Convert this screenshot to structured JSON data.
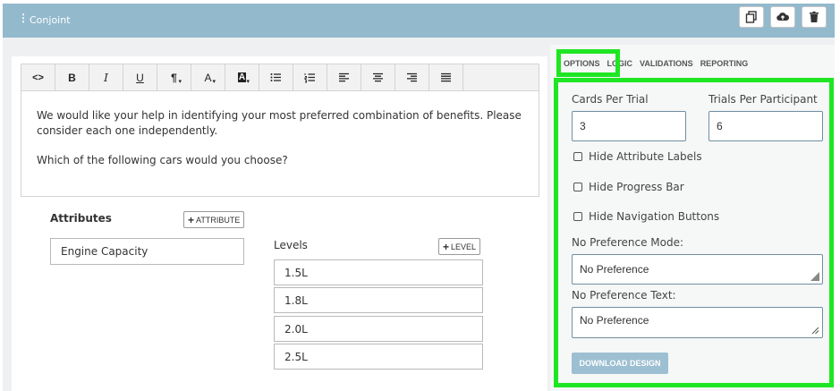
{
  "window": {
    "title": "Conjoint",
    "grip_glyph": "⋮",
    "actions": [
      {
        "name": "copy-icon"
      },
      {
        "name": "cloud-upload-icon"
      },
      {
        "name": "trash-icon"
      }
    ]
  },
  "editor": {
    "toolbar": [
      {
        "name": "code-view-icon",
        "glyph": "<>"
      },
      {
        "name": "bold-icon",
        "glyph": "B"
      },
      {
        "name": "italic-icon",
        "glyph": "I"
      },
      {
        "name": "underline-icon",
        "glyph": "U"
      },
      {
        "name": "paragraph-icon",
        "glyph": "¶"
      },
      {
        "name": "font-color-icon",
        "glyph": "A"
      },
      {
        "name": "background-color-icon",
        "glyph": "A"
      },
      {
        "name": "bullet-list-icon",
        "glyph": ""
      },
      {
        "name": "numbered-list-icon",
        "glyph": ""
      },
      {
        "name": "align-left-icon",
        "glyph": ""
      },
      {
        "name": "align-center-icon",
        "glyph": ""
      },
      {
        "name": "align-right-icon",
        "glyph": ""
      },
      {
        "name": "justify-icon",
        "glyph": ""
      }
    ],
    "paragraph1": "We would like your help in identifying your most preferred combination of benefits. Please consider each one independently.",
    "paragraph2": "Which of the following cars would you choose?"
  },
  "attributes": {
    "heading": "Attributes",
    "add_button": "ATTRIBUTE",
    "items": [
      "Engine Capacity"
    ]
  },
  "levels": {
    "heading": "Levels",
    "add_button": "LEVEL",
    "items": [
      "1.5L",
      "1.8L",
      "2.0L",
      "2.5L"
    ]
  },
  "tabs": [
    "OPTIONS",
    "LOGIC",
    "VALIDATIONS",
    "REPORTING"
  ],
  "options": {
    "cards_per_trial_label": "Cards Per Trial",
    "cards_per_trial_value": "3",
    "trials_per_participant_label": "Trials Per Participant",
    "trials_per_participant_value": "6",
    "checkboxes": [
      "Hide Attribute Labels",
      "Hide Progress Bar",
      "Hide Navigation Buttons"
    ],
    "no_pref_mode_label": "No Preference Mode:",
    "no_pref_mode_value": "No Preference",
    "no_pref_text_label": "No Preference Text:",
    "no_pref_text_value": "No Preference",
    "download_button": "DOWNLOAD DESIGN"
  },
  "colors": {
    "titlebar": "#93b9cc",
    "highlight": "#1ee623",
    "download_button": "#9dbfd2"
  }
}
